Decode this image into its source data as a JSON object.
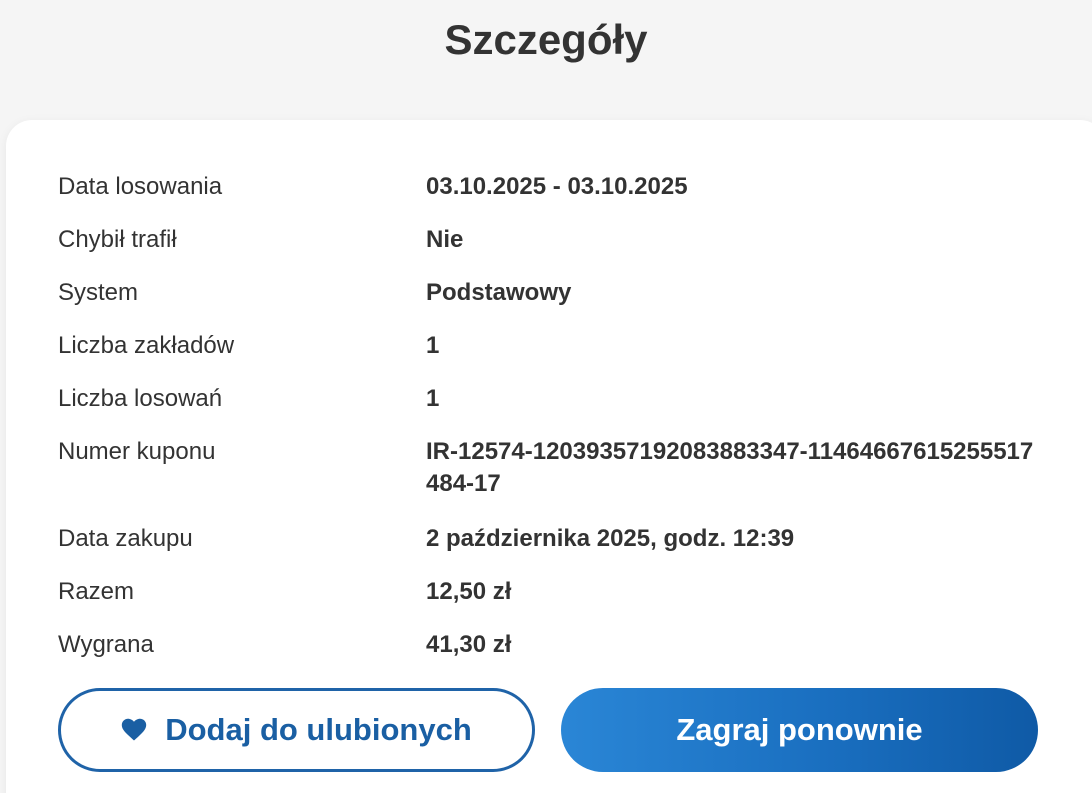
{
  "page": {
    "title": "Szczegóły"
  },
  "details": {
    "rows": [
      {
        "label": "Data losowania",
        "value": "03.10.2025 - 03.10.2025"
      },
      {
        "label": "Chybił trafił",
        "value": "Nie"
      },
      {
        "label": "System",
        "value": "Podstawowy"
      },
      {
        "label": "Liczba zakładów",
        "value": "1"
      },
      {
        "label": "Liczba losowań",
        "value": "1"
      },
      {
        "label": "Numer kuponu",
        "value": "IR-12574-1203935719208388334​7-11464667615255517484-17"
      },
      {
        "label": "Data zakupu",
        "value": "2 października 2025, godz. 12:39"
      },
      {
        "label": "Razem",
        "value": "12,50 zł"
      },
      {
        "label": "Wygrana",
        "value": "41,30 zł"
      }
    ]
  },
  "actions": {
    "favorite_label": "Dodaj do ulubionych",
    "favorite_icon": "heart-icon",
    "play_again_label": "Zagraj ponownie"
  },
  "colors": {
    "accent": "#1a5fa3",
    "button_gradient_start": "#2a86d6",
    "button_gradient_end": "#0f5aa6",
    "background": "#f5f5f5",
    "card": "#ffffff"
  }
}
